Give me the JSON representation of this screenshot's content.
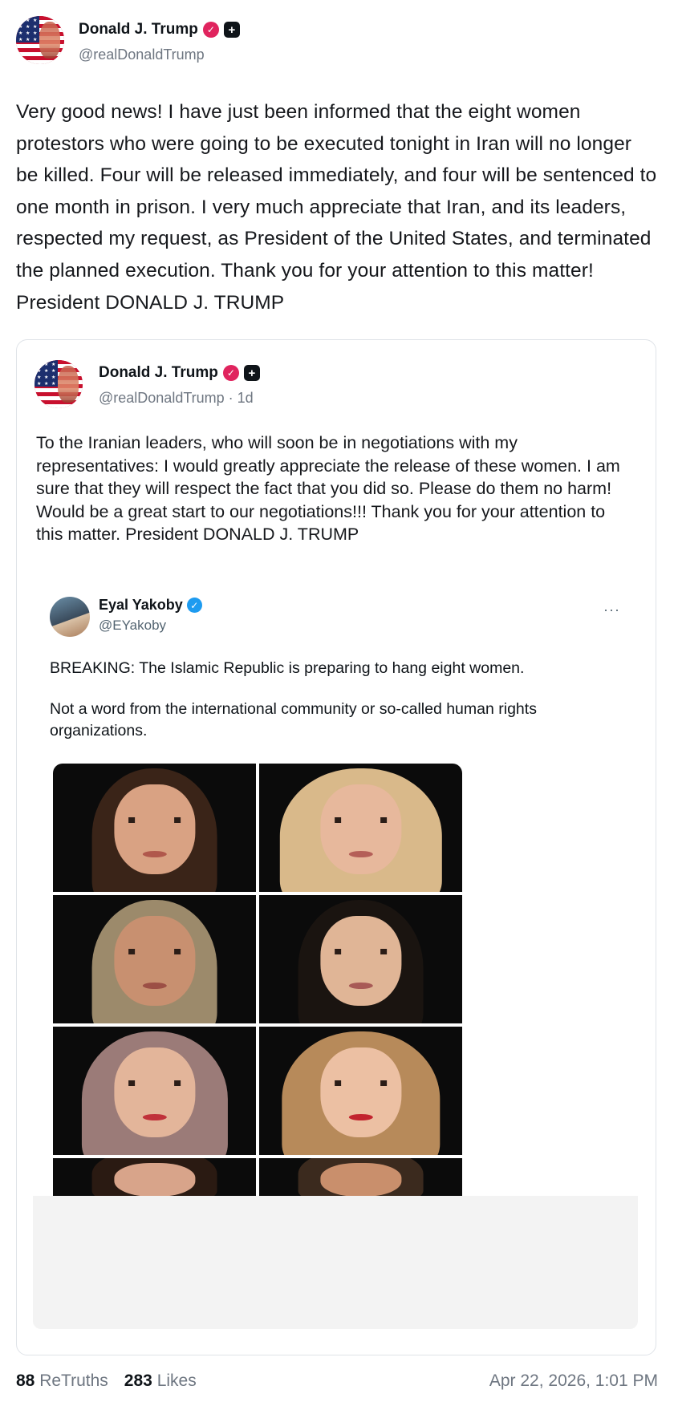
{
  "post": {
    "author": "Donald J. Trump",
    "handle": "@realDonaldTrump",
    "text": "Very good news! I have just been informed that the eight women protestors who were going to be executed tonight in Iran will no longer be killed. Four will be released immediately, and four will be sentenced to one month in prison. I very much appreciate that Iran, and its leaders, respected my request, as President of the United States, and terminated the planned execution. Thank you for your attention to this matter! President DONALD J. TRUMP",
    "retruths_count": "88",
    "retruths_label": "ReTruths",
    "likes_count": "283",
    "likes_label": "Likes",
    "timestamp": "Apr 22, 2026, 1:01 PM"
  },
  "quoted": {
    "author": "Donald J. Trump",
    "handle": "@realDonaldTrump · 1d",
    "text": "To the Iranian leaders, who will soon be in negotiations with my representatives: I would greatly appreciate the release of these women. I am sure that they will respect the fact that you did so. Please do them no harm! Would be a great start to our negotiations!!! Thank you for your attention to this matter. President DONALD J. TRUMP",
    "embedded": {
      "author": "Eyal Yakoby",
      "handle": "@EYakoby",
      "more": "···",
      "line1": "BREAKING: The Islamic Republic is preparing to hang eight women.",
      "line2": "Not a word from the international community or so-called human rights organizations."
    }
  },
  "icons": {
    "verified": "check-badge-icon",
    "plus": "plus-badge-icon",
    "x_verified": "blue-check-icon"
  },
  "colors": {
    "verified_badge": "#e0245e",
    "x_check": "#1d9bf0",
    "muted_text": "#6e7681"
  }
}
